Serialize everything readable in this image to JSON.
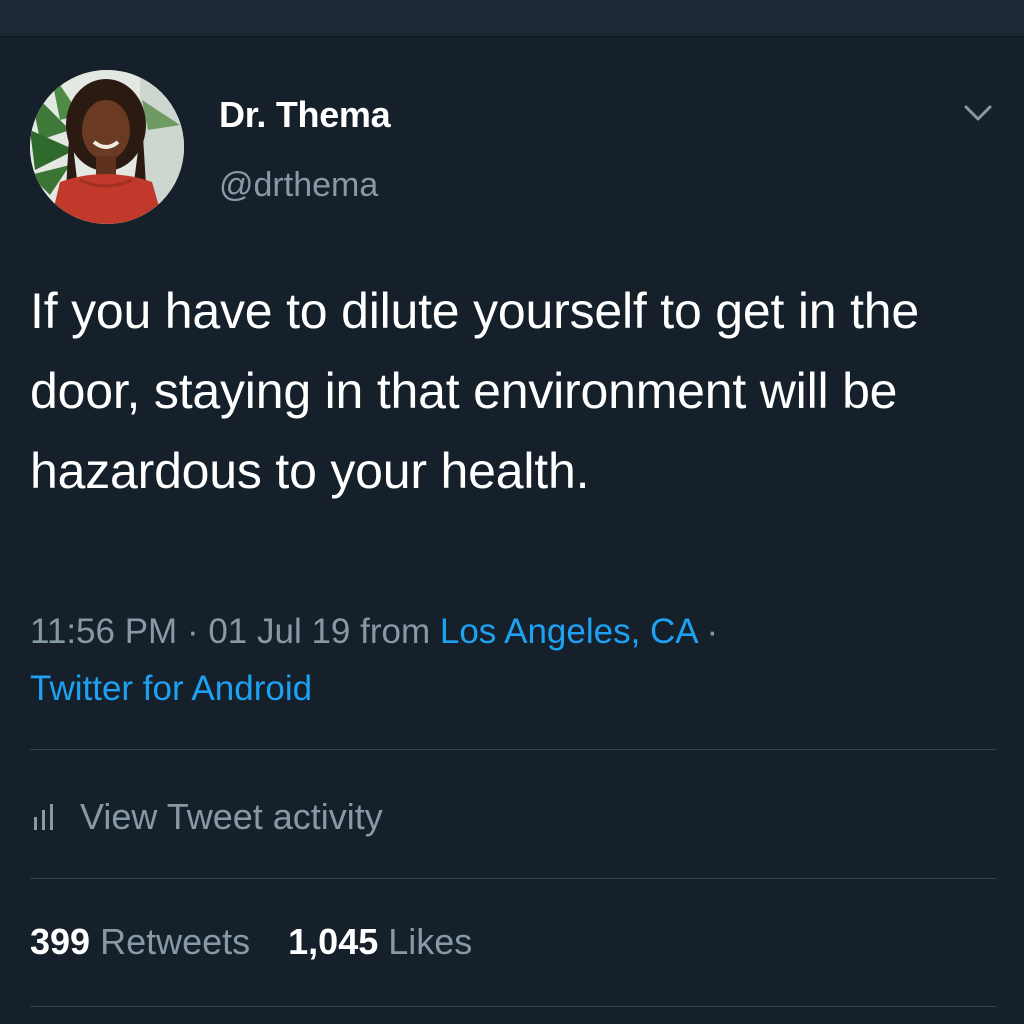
{
  "tweet": {
    "author": {
      "display_name": "Dr. Thema",
      "handle": "@drthema"
    },
    "text": "If you have to dilute yourself to get in the door, staying in that environment will be hazardous to your health.",
    "time": "11:56 PM",
    "date": "01 Jul 19",
    "from_label": "from",
    "location": "Los Angeles, CA",
    "client": "Twitter for Android"
  },
  "activity": {
    "label": "View Tweet activity"
  },
  "stats": {
    "retweets_count": "399",
    "retweets_label": "Retweets",
    "likes_count": "1,045",
    "likes_label": "Likes"
  },
  "colors": {
    "background": "#15202b",
    "link": "#1da1f2",
    "secondary_text": "#8899a6",
    "divider": "#38444d"
  }
}
